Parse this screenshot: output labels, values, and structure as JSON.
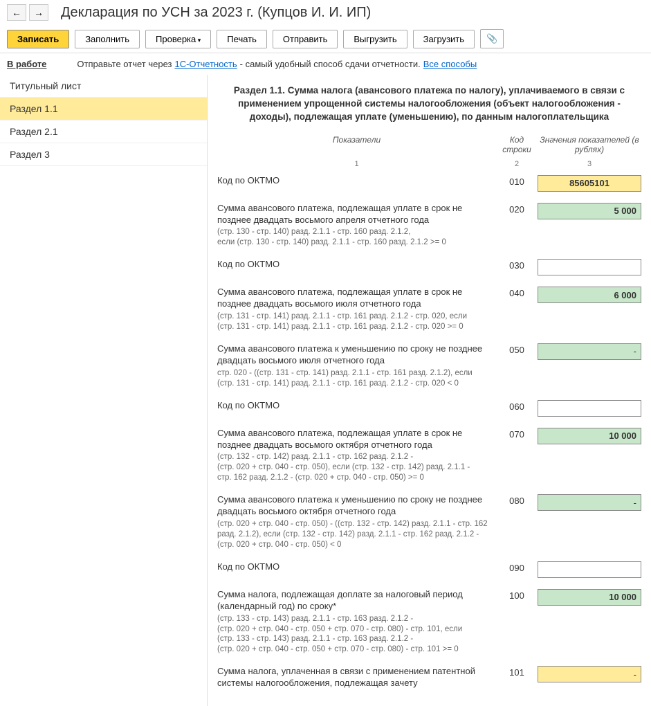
{
  "header": {
    "title": "Декларация по УСН за 2023 г. (Купцов И. И. ИП)"
  },
  "toolbar": {
    "save": "Записать",
    "fill": "Заполнить",
    "check": "Проверка",
    "print": "Печать",
    "send": "Отправить",
    "upload": "Выгрузить",
    "load": "Загрузить"
  },
  "info": {
    "status": "В работе",
    "send_text": "Отправьте отчет через ",
    "link1": "1С-Отчетность",
    "text2": " - самый удобный способ сдачи отчетности. ",
    "link2": "Все способы"
  },
  "sidebar": {
    "items": [
      "Титульный лист",
      "Раздел 1.1",
      "Раздел 2.1",
      "Раздел 3"
    ]
  },
  "section": {
    "title": "Раздел 1.1. Сумма налога (авансового платежа по налогу), уплачиваемого в связи с применением упрощенной системы налогообложения (объект налогообложения - доходы), подлежащая уплате (уменьшению), по данным налогоплательщика"
  },
  "columns": {
    "c1": "Показатели",
    "c2": "Код строки",
    "c3": "Значения показателей (в рублях)",
    "s1": "1",
    "s2": "2",
    "s3": "3"
  },
  "rows": [
    {
      "label": "Код по ОКТМО",
      "formula": "",
      "code": "010",
      "value": "85605101",
      "style": "yellow"
    },
    {
      "label": "Сумма авансового платежа, подлежащая уплате в срок не позднее двадцать восьмого апреля отчетного года",
      "formula": "(стр. 130 - стр. 140) разд. 2.1.1 - стр. 160 разд. 2.1.2,\nесли (стр. 130 - стр. 140) разд. 2.1.1 - стр. 160 разд. 2.1.2 >= 0",
      "code": "020",
      "value": "5 000",
      "style": "green"
    },
    {
      "label": "Код по ОКТМО",
      "formula": "",
      "code": "030",
      "value": "",
      "style": "white"
    },
    {
      "label": "Сумма авансового платежа, подлежащая уплате в срок не позднее двадцать восьмого июля отчетного года",
      "formula": "(стр. 131 - стр. 141) разд. 2.1.1 - стр. 161 разд. 2.1.2 - стр. 020, если\n(стр. 131 - стр. 141) разд. 2.1.1 - стр. 161 разд. 2.1.2 - стр. 020 >= 0",
      "code": "040",
      "value": "6 000",
      "style": "green"
    },
    {
      "label": "Сумма авансового платежа к уменьшению по сроку не позднее двадцать восьмого июля отчетного года",
      "formula": "стр. 020 - ((стр. 131 - стр. 141) разд. 2.1.1 - стр. 161 разд. 2.1.2), если\n(стр. 131 - стр. 141) разд. 2.1.1 - стр. 161 разд. 2.1.2 - стр. 020 < 0",
      "code": "050",
      "value": "-",
      "style": "green-dash"
    },
    {
      "label": "Код по ОКТМО",
      "formula": "",
      "code": "060",
      "value": "",
      "style": "white"
    },
    {
      "label": "Сумма авансового платежа, подлежащая уплате в срок не позднее двадцать восьмого октября отчетного года",
      "formula": "(стр. 132 - стр. 142) разд. 2.1.1 - стр. 162 разд. 2.1.2 -\n(стр. 020 + стр. 040 - стр. 050), если (стр. 132 - стр. 142) разд. 2.1.1 -\nстр. 162 разд. 2.1.2 - (стр. 020 + стр. 040 - стр. 050) >= 0",
      "code": "070",
      "value": "10 000",
      "style": "green"
    },
    {
      "label": "Сумма авансового платежа к уменьшению по сроку не позднее двадцать восьмого октября отчетного года",
      "formula": "(стр. 020 + стр. 040 - стр. 050) - ((стр. 132 - стр. 142) разд. 2.1.1 - стр. 162 разд. 2.1.2), если (стр. 132 - стр. 142) разд. 2.1.1 - стр. 162 разд. 2.1.2 - (стр. 020 + стр. 040 - стр. 050) < 0",
      "code": "080",
      "value": "-",
      "style": "green-dash"
    },
    {
      "label": "Код по ОКТМО",
      "formula": "",
      "code": "090",
      "value": "",
      "style": "white"
    },
    {
      "label": "Сумма налога, подлежащая доплате за налоговый период (календарный год) по сроку*",
      "formula": "(стр. 133 - стр. 143) разд. 2.1.1 - стр. 163 разд. 2.1.2 -\n(стр. 020 + стр. 040 - стр. 050 + стр. 070 - стр. 080) - стр. 101, если\n(стр. 133 - стр. 143) разд. 2.1.1 - стр. 163 разд. 2.1.2 -\n(стр. 020 + стр. 040 - стр. 050 + стр. 070 - стр. 080) - стр. 101 >= 0",
      "code": "100",
      "value": "10 000",
      "style": "green"
    },
    {
      "label": "Сумма налога, уплаченная в связи с применением патентной системы налогообложения, подлежащая зачету",
      "formula": "",
      "code": "101",
      "value": "-",
      "style": "yellow-dash"
    }
  ]
}
